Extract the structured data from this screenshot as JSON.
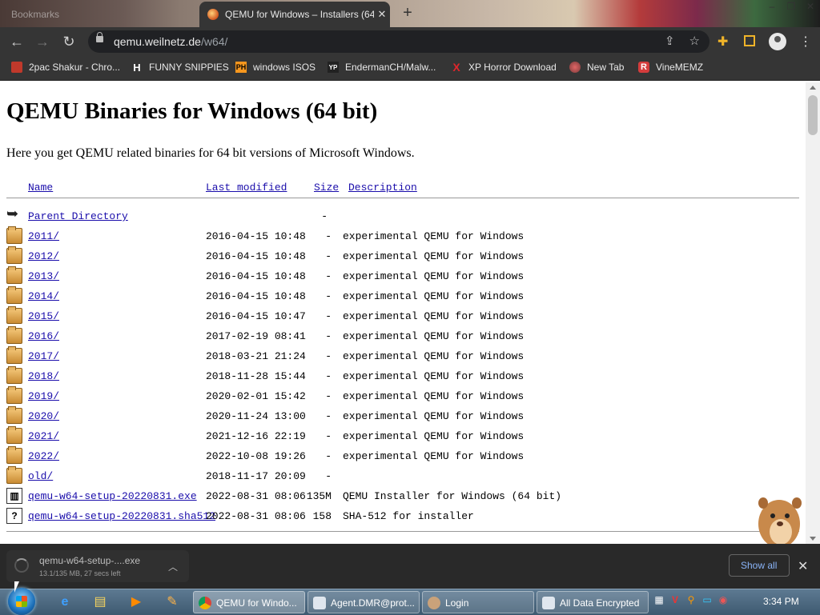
{
  "browser": {
    "bookmarks_tab_label": "Bookmarks",
    "active_tab_title": "QEMU for Windows – Installers (64 bit)",
    "url_domain": "qemu.weilnetz.de",
    "url_path": "/w64/",
    "bookmarks": [
      {
        "label": "2pac Shakur - Chro...",
        "icon": "image-icon",
        "color": "#c0392b"
      },
      {
        "label": "FUNNY SNIPPIES",
        "icon": "H",
        "color": "#ffffff"
      },
      {
        "label": "windows ISOS",
        "icon": "PH",
        "color": "#f7971e"
      },
      {
        "label": "EndermanCH/Malw...",
        "icon": "YP",
        "color": "#222222"
      },
      {
        "label": "XP Horror Download",
        "icon": "X",
        "color": "#e0262b"
      },
      {
        "label": "New Tab",
        "icon": "globe-icon",
        "color": "#c0392b"
      },
      {
        "label": "VineMEMZ",
        "icon": "R",
        "color": "#d43c3c"
      }
    ]
  },
  "page": {
    "title": "QEMU Binaries for Windows (64 bit)",
    "intro": "Here you get QEMU related binaries for 64 bit versions of Microsoft Windows.",
    "columns": {
      "name": "Name",
      "modified": "Last modified",
      "size": "Size",
      "description": "Description"
    },
    "parent": {
      "name": "Parent Directory",
      "size": "-"
    },
    "rows": [
      {
        "name": "2011/",
        "date": "2016-04-15 10:48",
        "size": "-",
        "desc": "experimental QEMU for Windows",
        "type": "folder"
      },
      {
        "name": "2012/",
        "date": "2016-04-15 10:48",
        "size": "-",
        "desc": "experimental QEMU for Windows",
        "type": "folder"
      },
      {
        "name": "2013/",
        "date": "2016-04-15 10:48",
        "size": "-",
        "desc": "experimental QEMU for Windows",
        "type": "folder"
      },
      {
        "name": "2014/",
        "date": "2016-04-15 10:48",
        "size": "-",
        "desc": "experimental QEMU for Windows",
        "type": "folder"
      },
      {
        "name": "2015/",
        "date": "2016-04-15 10:47",
        "size": "-",
        "desc": "experimental QEMU for Windows",
        "type": "folder"
      },
      {
        "name": "2016/",
        "date": "2017-02-19 08:41",
        "size": "-",
        "desc": "experimental QEMU for Windows",
        "type": "folder"
      },
      {
        "name": "2017/",
        "date": "2018-03-21 21:24",
        "size": "-",
        "desc": "experimental QEMU for Windows",
        "type": "folder"
      },
      {
        "name": "2018/",
        "date": "2018-11-28 15:44",
        "size": "-",
        "desc": "experimental QEMU for Windows",
        "type": "folder"
      },
      {
        "name": "2019/",
        "date": "2020-02-01 15:42",
        "size": "-",
        "desc": "experimental QEMU for Windows",
        "type": "folder"
      },
      {
        "name": "2020/",
        "date": "2020-11-24 13:00",
        "size": "-",
        "desc": "experimental QEMU for Windows",
        "type": "folder"
      },
      {
        "name": "2021/",
        "date": "2021-12-16 22:19",
        "size": "-",
        "desc": "experimental QEMU for Windows",
        "type": "folder"
      },
      {
        "name": "2022/",
        "date": "2022-10-08 19:26",
        "size": "-",
        "desc": "experimental QEMU for Windows",
        "type": "folder"
      },
      {
        "name": "old/",
        "date": "2018-11-17 20:09",
        "size": "-",
        "desc": "",
        "type": "folder"
      },
      {
        "name": "qemu-w64-setup-20220831.exe",
        "date": "2022-08-31 08:06",
        "size": "135M",
        "desc": "QEMU Installer for Windows (64 bit)",
        "type": "binary"
      },
      {
        "name": "qemu-w64-setup-20220831.sha512",
        "date": "2022-08-31 08:06",
        "size": "158",
        "desc": "SHA-512 for installer",
        "type": "unknown"
      }
    ]
  },
  "download": {
    "filename": "qemu-w64-setup-....exe",
    "progress": "13.1/135 MB, 27 secs left",
    "show_all": "Show all"
  },
  "taskbar": {
    "tasks": [
      {
        "label": "QEMU for Windo...",
        "icon": "chrome-icon"
      },
      {
        "label": "Agent.DMR@prot...",
        "icon": "window-icon"
      },
      {
        "label": "Login",
        "icon": "user-icon"
      },
      {
        "label": "All Data Encrypted",
        "icon": "window-icon"
      }
    ],
    "clock": "3:34 PM"
  },
  "colors": {
    "link": "#1a0dab",
    "browser_chrome": "#353535",
    "taskbar": "#4a6880"
  }
}
